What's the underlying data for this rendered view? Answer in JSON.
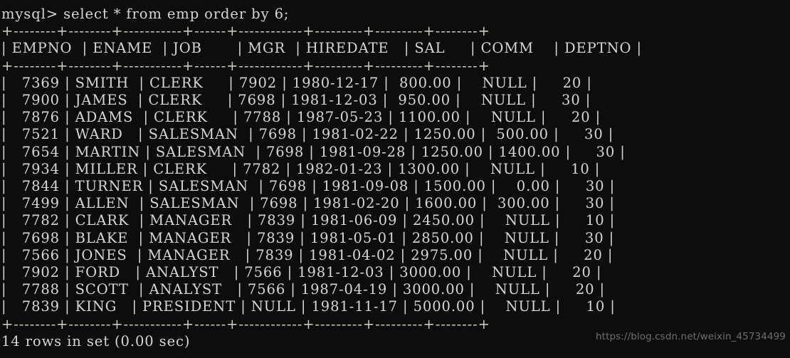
{
  "terminal": {
    "prompt": "mysql> ",
    "command": "select * from emp order by 6;",
    "prompt_line": "mysql> select * from emp order by 6;",
    "footer": "14 rows in set (0.00 sec)",
    "rows_count": "14",
    "elapsed": "0.00 sec",
    "background_color": "#0d0d0d",
    "text_color": "#d6d6d6",
    "rule_color": "#cfc9bd"
  },
  "watermark": {
    "text": "https://blog.csdn.net/weixin_45734499",
    "color": "#6f6f6f"
  },
  "table": {
    "border_rule": "+--------+--------+-----------+------+------------+---------+---------+--------+",
    "columns": [
      {
        "name": "EMPNO",
        "width": 6,
        "align": "right"
      },
      {
        "name": "ENAME",
        "width": 6,
        "align": "left"
      },
      {
        "name": "JOB",
        "width": 9,
        "align": "left"
      },
      {
        "name": "MGR",
        "width": 4,
        "align": "right"
      },
      {
        "name": "HIREDATE",
        "width": 10,
        "align": "left"
      },
      {
        "name": "SAL",
        "width": 7,
        "align": "right"
      },
      {
        "name": "COMM",
        "width": 7,
        "align": "right"
      },
      {
        "name": "DEPTNO",
        "width": 6,
        "align": "right"
      }
    ],
    "headers": [
      "EMPNO",
      "ENAME",
      "JOB",
      "MGR",
      "HIREDATE",
      "SAL",
      "COMM",
      "DEPTNO"
    ],
    "rows": [
      [
        "7369",
        "SMITH",
        "CLERK",
        "7902",
        "1980-12-17",
        "800.00",
        "NULL",
        "20"
      ],
      [
        "7900",
        "JAMES",
        "CLERK",
        "7698",
        "1981-12-03",
        "950.00",
        "NULL",
        "30"
      ],
      [
        "7876",
        "ADAMS",
        "CLERK",
        "7788",
        "1987-05-23",
        "1100.00",
        "NULL",
        "20"
      ],
      [
        "7521",
        "WARD",
        "SALESMAN",
        "7698",
        "1981-02-22",
        "1250.00",
        "500.00",
        "30"
      ],
      [
        "7654",
        "MARTIN",
        "SALESMAN",
        "7698",
        "1981-09-28",
        "1250.00",
        "1400.00",
        "30"
      ],
      [
        "7934",
        "MILLER",
        "CLERK",
        "7782",
        "1982-01-23",
        "1300.00",
        "NULL",
        "10"
      ],
      [
        "7844",
        "TURNER",
        "SALESMAN",
        "7698",
        "1981-09-08",
        "1500.00",
        "0.00",
        "30"
      ],
      [
        "7499",
        "ALLEN",
        "SALESMAN",
        "7698",
        "1981-02-20",
        "1600.00",
        "300.00",
        "30"
      ],
      [
        "7782",
        "CLARK",
        "MANAGER",
        "7839",
        "1981-06-09",
        "2450.00",
        "NULL",
        "10"
      ],
      [
        "7698",
        "BLAKE",
        "MANAGER",
        "7839",
        "1981-05-01",
        "2850.00",
        "NULL",
        "30"
      ],
      [
        "7566",
        "JONES",
        "MANAGER",
        "7839",
        "1981-04-02",
        "2975.00",
        "NULL",
        "20"
      ],
      [
        "7902",
        "FORD",
        "ANALYST",
        "7566",
        "1981-12-03",
        "3000.00",
        "NULL",
        "20"
      ],
      [
        "7788",
        "SCOTT",
        "ANALYST",
        "7566",
        "1987-04-19",
        "3000.00",
        "NULL",
        "20"
      ],
      [
        "7839",
        "KING",
        "PRESIDENT",
        "NULL",
        "1981-11-17",
        "5000.00",
        "NULL",
        "10"
      ]
    ]
  }
}
